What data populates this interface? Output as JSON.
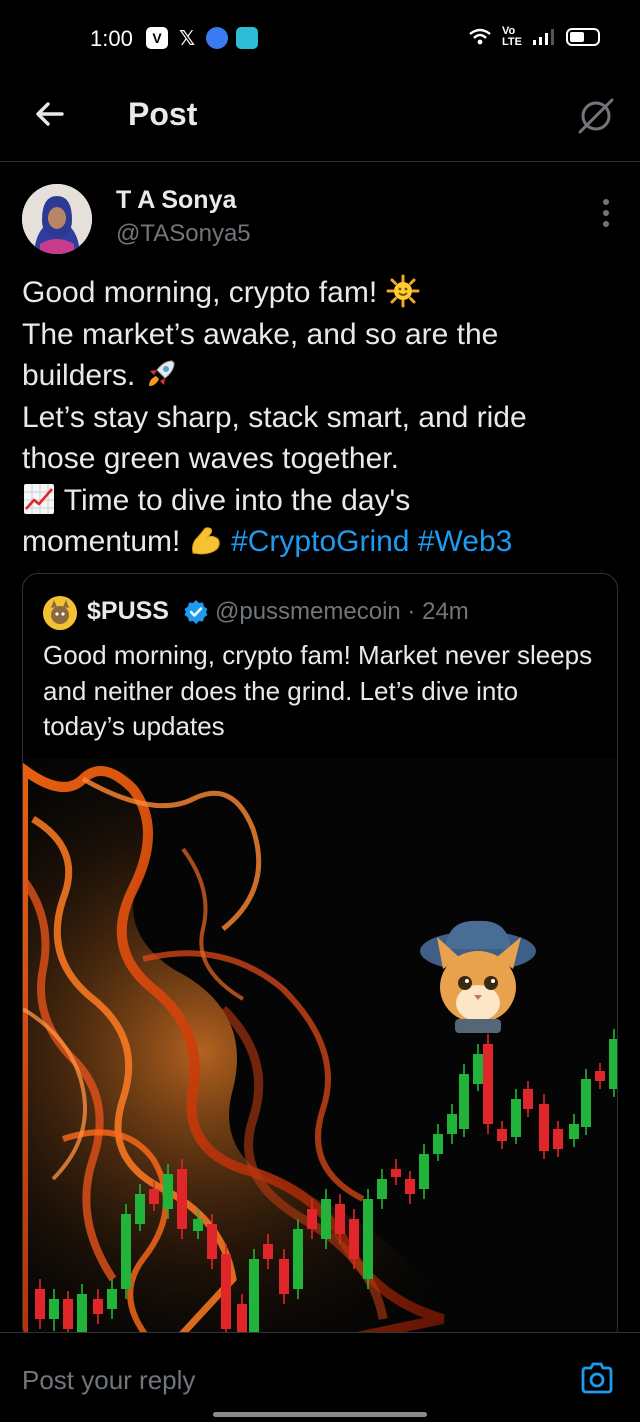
{
  "status_bar": {
    "time": "1:00",
    "network_label": "Vo LTE",
    "notification_icons": [
      "v-app-icon",
      "x-app-icon",
      "blue-app-icon",
      "chat-app-icon"
    ]
  },
  "header": {
    "title": "Post"
  },
  "author": {
    "name": "T A Sonya",
    "handle": "@TASonya5"
  },
  "post": {
    "lines": [
      "Good morning, crypto fam!",
      "The market’s awake, and so are the",
      "builders.",
      "Let’s stay sharp, stack smart, and ride",
      "those green waves together.",
      "Time to dive into the day's",
      "momentum!"
    ],
    "hashtag_1": "#CryptoGrind",
    "hashtag_2": "#Web3"
  },
  "quote": {
    "name": "$PUSS",
    "handle": "@pussmemecoin · 24m",
    "text": "Good morning, crypto fam!  Market never sleeps and neither does the grind. Let’s dive into today’s updates"
  },
  "reply": {
    "placeholder": "Post your reply"
  },
  "colors": {
    "background": "#000000",
    "text": "#e7e9ea",
    "muted": "#71767b",
    "accent": "#1d9bf0",
    "divider": "#2f3336",
    "candle_up": "#22b33a",
    "candle_down": "#e0252b"
  }
}
